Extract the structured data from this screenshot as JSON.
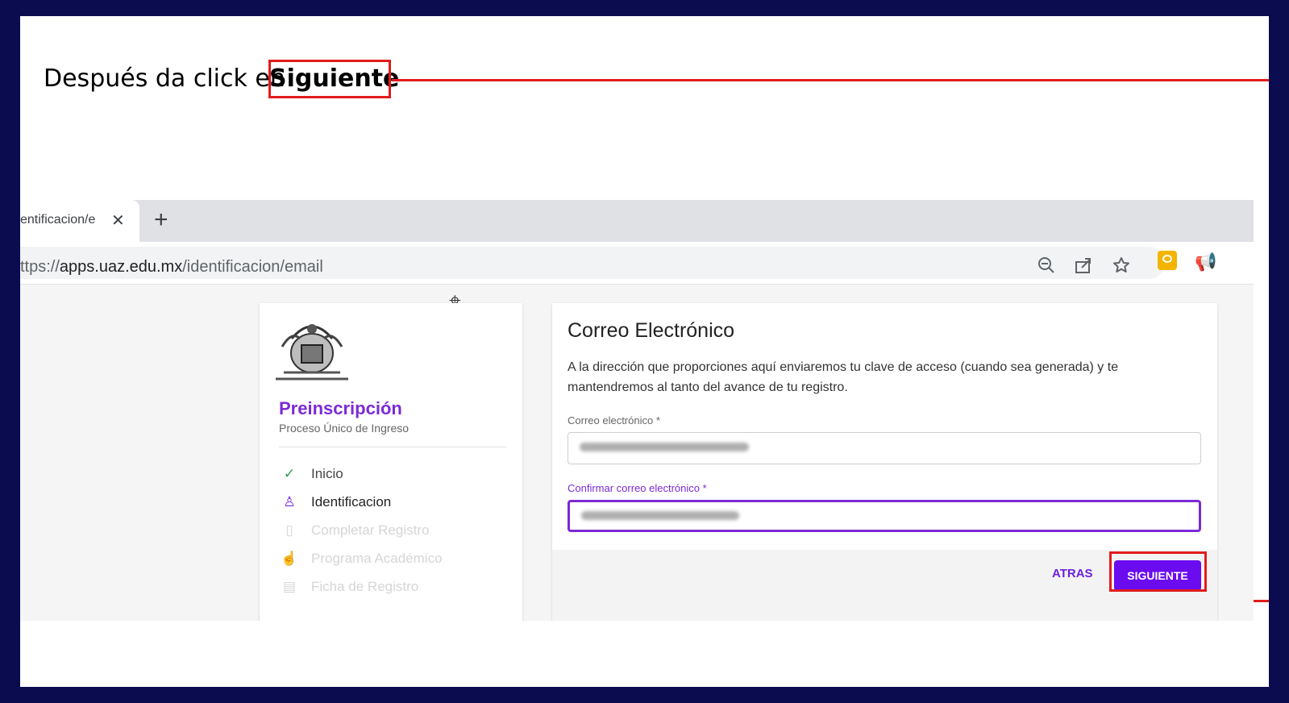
{
  "instruction": {
    "text": "Después da click en",
    "highlight": "Siguiente"
  },
  "browser": {
    "tab_title": "entificacion/e",
    "url_scheme": "ttps://",
    "url_host": "apps.uaz.edu.mx",
    "url_path": "/identificacion/email",
    "icons": [
      "zoom-out-icon",
      "share-icon",
      "bookmark-star-icon",
      "extension-yellow-icon",
      "extension-megaphone-icon"
    ]
  },
  "sidebar": {
    "title": "Preinscripción",
    "subtitle": "Proceso Único de Ingreso",
    "steps": [
      {
        "label": "Inicio",
        "state": "done",
        "icon": "check-icon"
      },
      {
        "label": "Identificacion",
        "state": "current",
        "icon": "person-icon"
      },
      {
        "label": "Completar Registro",
        "state": "disabled",
        "icon": "book-icon"
      },
      {
        "label": "Programa Académico",
        "state": "disabled",
        "icon": "hand-pointer-icon"
      },
      {
        "label": "Ficha de Registro",
        "state": "disabled",
        "icon": "document-icon"
      }
    ]
  },
  "form": {
    "title": "Correo Electrónico",
    "description": "A la dirección que proporciones aquí enviaremos tu clave de acceso (cuando sea generada) y te mantendremos al tanto del avance de tu registro.",
    "email_label": "Correo electrónico *",
    "confirm_label": "Confirmar correo electrónico *",
    "back_label": "ATRAS",
    "next_label": "SIGUIENTE"
  },
  "colors": {
    "accent": "#6b0bf0",
    "callout": "#e21b1b",
    "frame": "#0b0c4f"
  }
}
